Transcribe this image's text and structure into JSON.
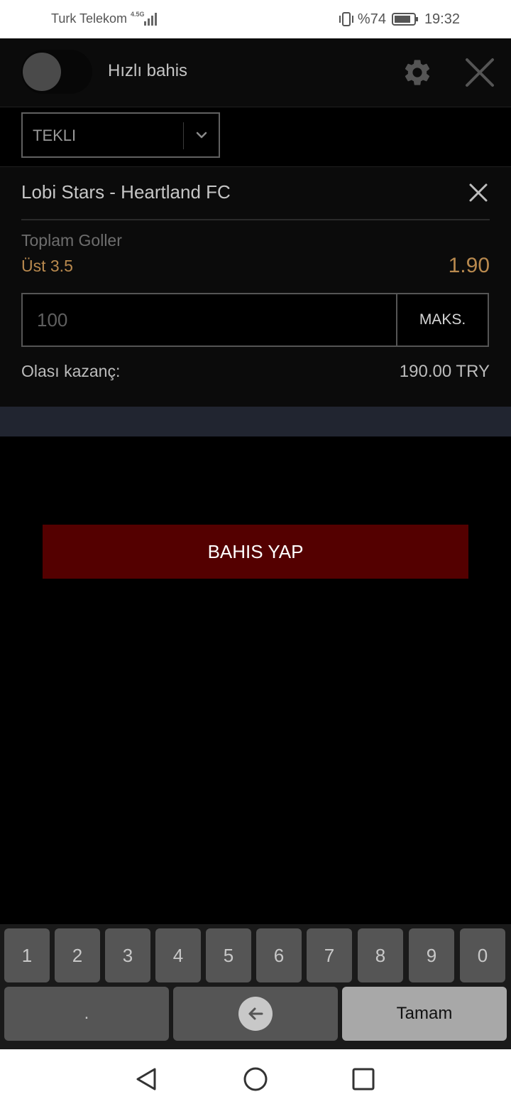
{
  "status_bar": {
    "carrier": "Turk Telekom",
    "network_type": "4.5G",
    "battery_percent": "%74",
    "time": "19:32"
  },
  "header": {
    "quick_bet_label": "Hızlı bahis",
    "quick_bet_enabled": false
  },
  "bet_type": {
    "selected": "TEKLI"
  },
  "bet": {
    "match": "Lobi Stars - Heartland FC",
    "market": "Toplam Goller",
    "selection": "Üst 3.5",
    "odds": "1.90",
    "stake_placeholder": "100",
    "max_label": "MAKS.",
    "winnings_label": "Olası kazanç:",
    "winnings_value": "190.00 TRY"
  },
  "place_bet_label": "BAHIS YAP",
  "keyboard": {
    "digits": [
      "1",
      "2",
      "3",
      "4",
      "5",
      "6",
      "7",
      "8",
      "9",
      "0"
    ],
    "dot": ".",
    "done": "Tamam"
  },
  "colors": {
    "accent_odds": "#b8894e",
    "place_bet_bg": "#540000",
    "band": "#212530"
  },
  "icons": {
    "settings": "gear-icon",
    "close": "close-icon",
    "remove": "remove-selection-icon",
    "dropdown": "chevron-down-icon",
    "backspace": "backspace-icon"
  }
}
